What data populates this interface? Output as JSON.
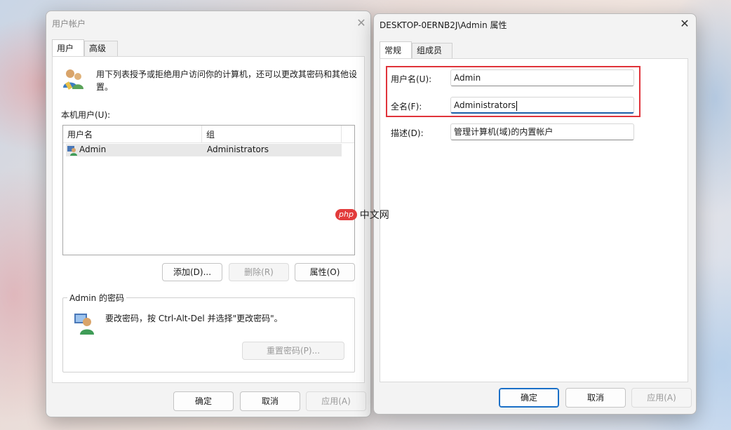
{
  "left_window": {
    "title": "用户帐户",
    "tabs": [
      {
        "label": "用户"
      },
      {
        "label": "高级"
      }
    ],
    "description": "用下列表授予或拒绝用户访问你的计算机，还可以更改其密码和其他设置。",
    "users_label": "本机用户(U):",
    "columns": {
      "username": "用户名",
      "group": "组"
    },
    "rows": [
      {
        "username": "Admin",
        "group": "Administrators"
      }
    ],
    "buttons": {
      "add": "添加(D)...",
      "remove": "删除(R)",
      "properties": "属性(O)"
    },
    "password_group": {
      "title": "Admin 的密码",
      "text": "要改密码，按 Ctrl-Alt-Del 并选择\"更改密码\"。",
      "reset_button": "重置密码(P)..."
    },
    "footer": {
      "ok": "确定",
      "cancel": "取消",
      "apply": "应用(A)"
    }
  },
  "right_window": {
    "title": "DESKTOP-0ERNB2J\\Admin 属性",
    "tabs": [
      {
        "label": "常规"
      },
      {
        "label": "组成员"
      }
    ],
    "fields": {
      "username": {
        "label": "用户名(U):",
        "value": "Admin"
      },
      "fullname": {
        "label": "全名(F):",
        "value": "Administrators"
      },
      "description": {
        "label": "描述(D):",
        "value": "管理计算机(域)的内置帐户"
      }
    },
    "footer": {
      "ok": "确定",
      "cancel": "取消",
      "apply": "应用(A)"
    }
  },
  "watermark": {
    "badge": "php",
    "text": "中文网"
  },
  "colors": {
    "highlight_box": "#e0333a",
    "accent": "#1a6fc7",
    "focus_underline": "#1c5fa8"
  }
}
